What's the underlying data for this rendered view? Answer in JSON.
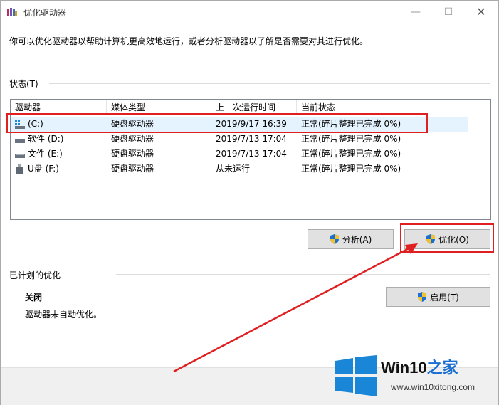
{
  "window": {
    "title": "优化驱动器",
    "intro": "你可以优化驱动器以帮助计算机更高效地运行，或者分析驱动器以了解是否需要对其进行优化。",
    "min_glyph": "—",
    "max_glyph": "☐",
    "close_glyph": "✕"
  },
  "status": {
    "label": "状态(T)",
    "columns": [
      "驱动器",
      "媒体类型",
      "上一次运行时间",
      "当前状态"
    ],
    "rows": [
      {
        "drive": "(C:)",
        "media": "硬盘驱动器",
        "last_run": "2019/9/17 16:39",
        "state": "正常(碎片整理已完成 0%)",
        "icon": "system-drive-icon",
        "selected": true
      },
      {
        "drive": "软件 (D:)",
        "media": "硬盘驱动器",
        "last_run": "2019/7/13 17:04",
        "state": "正常(碎片整理已完成 0%)",
        "icon": "hard-drive-icon",
        "selected": false
      },
      {
        "drive": "文件 (E:)",
        "media": "硬盘驱动器",
        "last_run": "2019/7/13 17:04",
        "state": "正常(碎片整理已完成 0%)",
        "icon": "hard-drive-icon",
        "selected": false
      },
      {
        "drive": "U盘 (F:)",
        "media": "硬盘驱动器",
        "last_run": "从未运行",
        "state": "正常(碎片整理已完成 0%)",
        "icon": "usb-drive-icon",
        "selected": false
      }
    ]
  },
  "actions": {
    "analyze_label": "分析(A)",
    "optimize_label": "优化(O)"
  },
  "scheduled": {
    "label": "已计划的优化",
    "state": "关闭",
    "description": "驱动器未自动优化。",
    "enable_label": "启用(T)"
  },
  "watermark": {
    "brand": "Win10",
    "brand_suffix": "之家",
    "url": "www.win10xitong.com"
  },
  "colors": {
    "highlight": "#e02020",
    "selected_row": "#e5f3ff",
    "win_logo": "#1a86d8"
  }
}
